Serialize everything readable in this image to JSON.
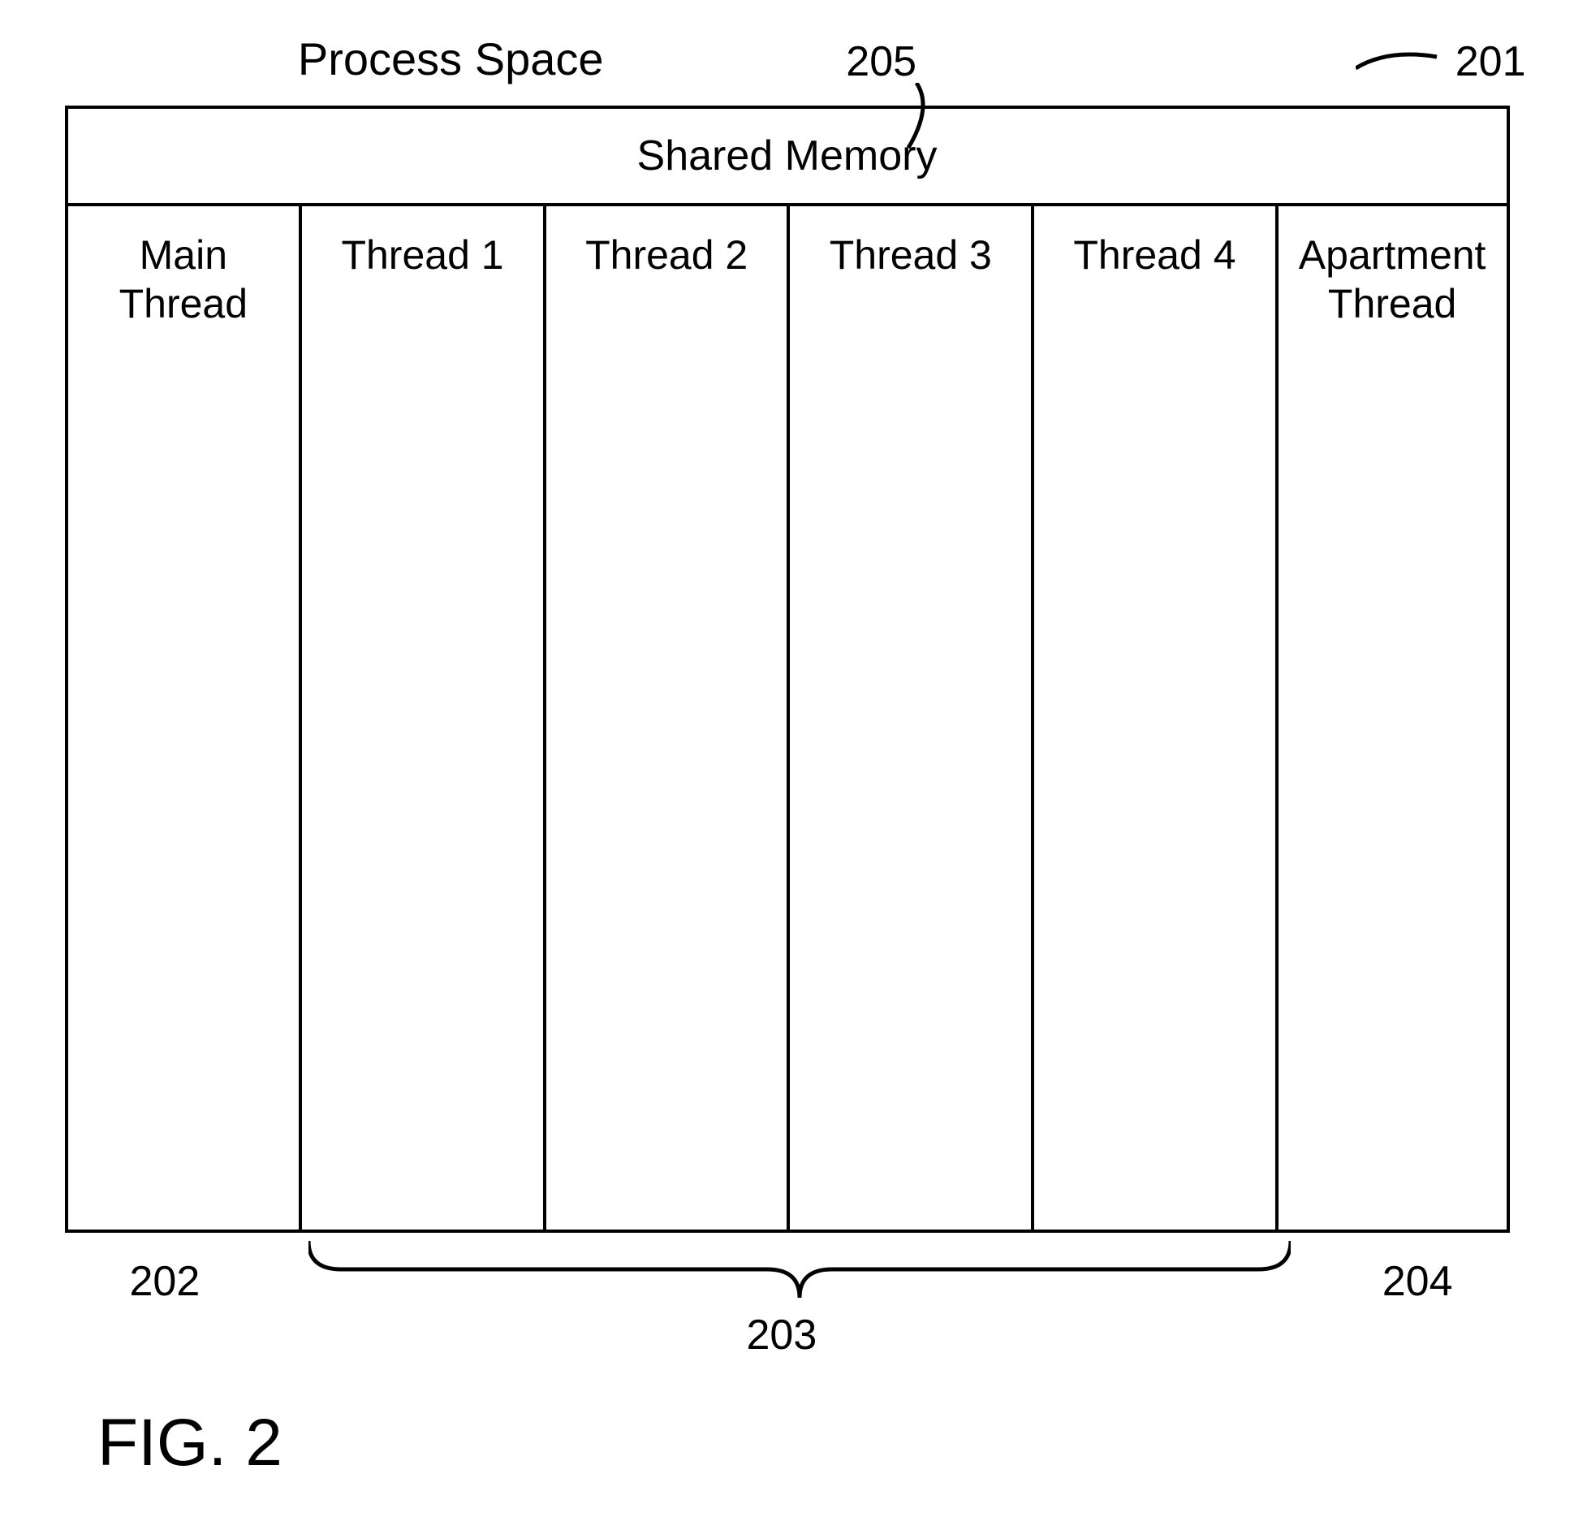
{
  "title": "Process Space",
  "refs": {
    "r201": "201",
    "r202": "202",
    "r203": "203",
    "r204": "204",
    "r205": "205"
  },
  "shared_memory": "Shared Memory",
  "threads": {
    "main": "Main\nThread",
    "t1": "Thread 1",
    "t2": "Thread 2",
    "t3": "Thread 3",
    "t4": "Thread 4",
    "apartment": "Apartment\nThread"
  },
  "figure_label": "FIG. 2"
}
